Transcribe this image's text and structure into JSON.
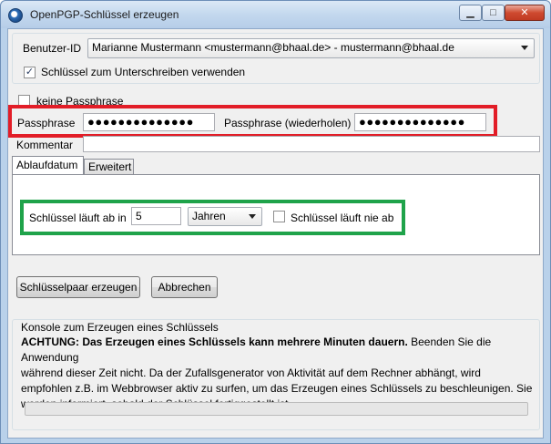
{
  "window": {
    "title": "OpenPGP-Schlüssel erzeugen",
    "controls": {
      "minimize": "▁",
      "maximize": "□",
      "close": "✕"
    }
  },
  "user_id": {
    "label": "Benutzer-ID",
    "selected": "Marianne Mustermann <mustermann@bhaal.de> - mustermann@bhaal.de"
  },
  "use_for_signing": {
    "label": "Schlüssel zum Unterschreiben verwenden",
    "checked": true
  },
  "no_passphrase": {
    "label": "keine Passphrase",
    "checked": false
  },
  "passphrase": {
    "label": "Passphrase",
    "value": "●●●●●●●●●●●●●●",
    "repeat_label": "Passphrase (wiederholen)",
    "repeat_value": "●●●●●●●●●●●●●●"
  },
  "comment": {
    "label": "Kommentar",
    "value": ""
  },
  "tabs": [
    {
      "label": "Ablaufdatum",
      "active": true
    },
    {
      "label": "Erweitert",
      "active": false
    }
  ],
  "expiry": {
    "label": "Schlüssel läuft ab in",
    "value": "5",
    "unit": "Jahren",
    "never_label": "Schlüssel läuft nie ab",
    "never_checked": false
  },
  "buttons": {
    "generate": "Schlüsselpaar erzeugen",
    "cancel": "Abbrechen"
  },
  "console": {
    "title": "Konsole zum Erzeugen eines Schlüssels",
    "warning_bold": "ACHTUNG: Das Erzeugen eines Schlüssels kann mehrere Minuten dauern.",
    "line1_rest": " Beenden Sie die Anwendung",
    "line2": "während dieser Zeit nicht. Da der Zufallsgenerator von Aktivität auf dem Rechner abhängt, wird",
    "line3": "empfohlen z.B. im Webbrowser aktiv zu surfen, um das Erzeugen eines Schlüssels zu beschleunigen. Sie",
    "line4": "werden informiert, sobald der Schlüssel fertiggestellt ist.",
    "progress": 0
  },
  "colors": {
    "highlight_red": "#e21d27",
    "highlight_green": "#1fa34a",
    "progress": "#06b025"
  }
}
